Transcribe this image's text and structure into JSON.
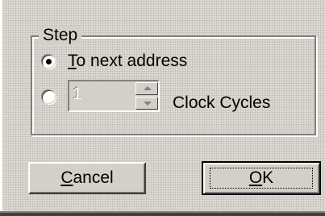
{
  "dialog": {
    "group": {
      "title": "Step"
    },
    "options": {
      "next_address": {
        "accel": "T",
        "rest": "o next address",
        "selected": true
      },
      "clock_cycles": {
        "selected": false,
        "value": "1",
        "label": "Clock Cycles",
        "enabled": false
      }
    },
    "buttons": {
      "cancel": {
        "accel": "C",
        "rest": "ancel"
      },
      "ok": {
        "accel": "O",
        "rest": "K"
      }
    }
  }
}
